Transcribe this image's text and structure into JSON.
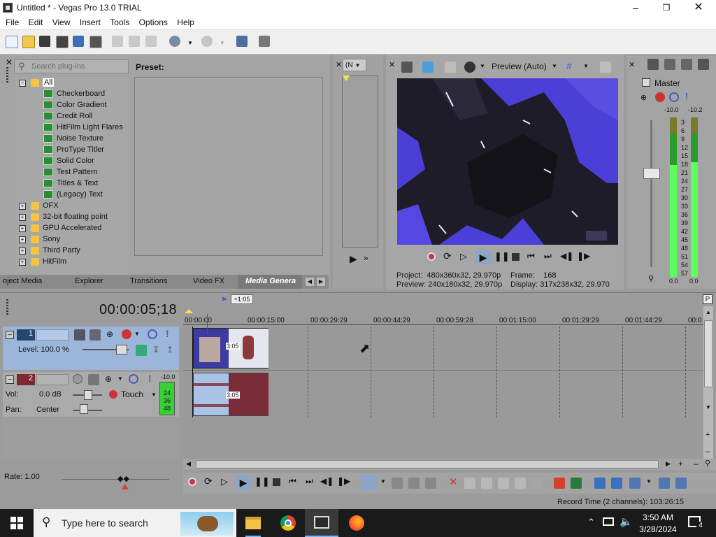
{
  "window": {
    "title": "Untitled * - Vegas Pro 13.0 TRIAL"
  },
  "menu": [
    "File",
    "Edit",
    "View",
    "Insert",
    "Tools",
    "Options",
    "Help"
  ],
  "plugins": {
    "search_placeholder": "Search plug-ins",
    "preset_label": "Preset:",
    "tree": [
      {
        "label": "All",
        "level": 0,
        "type": "folder",
        "expanded": true,
        "selected": true
      },
      {
        "label": "Checkerboard",
        "level": 1,
        "type": "plugin"
      },
      {
        "label": "Color Gradient",
        "level": 1,
        "type": "plugin"
      },
      {
        "label": "Credit Roll",
        "level": 1,
        "type": "plugin"
      },
      {
        "label": "HitFilm Light Flares",
        "level": 1,
        "type": "plugin"
      },
      {
        "label": "Noise Texture",
        "level": 1,
        "type": "plugin"
      },
      {
        "label": "ProType Titler",
        "level": 1,
        "type": "plugin"
      },
      {
        "label": "Solid Color",
        "level": 1,
        "type": "plugin"
      },
      {
        "label": "Test Pattern",
        "level": 1,
        "type": "plugin"
      },
      {
        "label": "Titles & Text",
        "level": 1,
        "type": "plugin"
      },
      {
        "label": "(Legacy) Text",
        "level": 1,
        "type": "plugin"
      },
      {
        "label": "OFX",
        "level": 0,
        "type": "folder"
      },
      {
        "label": "32-bit floating point",
        "level": 0,
        "type": "folder"
      },
      {
        "label": "GPU Accelerated",
        "level": 0,
        "type": "folder"
      },
      {
        "label": "Sony",
        "level": 0,
        "type": "folder"
      },
      {
        "label": "Third Party",
        "level": 0,
        "type": "folder"
      },
      {
        "label": "HitFilm",
        "level": 0,
        "type": "folder"
      }
    ]
  },
  "tabs": [
    {
      "label": "oject Media",
      "active": false
    },
    {
      "label": "Explorer",
      "active": false
    },
    {
      "label": "Transitions",
      "active": false
    },
    {
      "label": "Video FX",
      "active": false
    },
    {
      "label": "Media Genera",
      "active": true
    }
  ],
  "trimmer": {
    "dropdown": "(N"
  },
  "preview": {
    "mode_label": "Preview (Auto)",
    "project_label": "Project:",
    "project_value": "480x360x32, 29.970p",
    "frame_label": "Frame:",
    "frame_value": "168",
    "preview_label": "Preview:",
    "preview_value": "240x180x32, 29.970p",
    "display_label": "Display:",
    "display_value": "317x238x32, 29.970"
  },
  "master": {
    "label": "Master",
    "peak_left": "-10.0",
    "peak_right": "-10.2",
    "scale": [
      "3",
      "6",
      "9",
      "12",
      "15",
      "18",
      "21",
      "24",
      "27",
      "30",
      "33",
      "36",
      "39",
      "42",
      "45",
      "48",
      "51",
      "54",
      "57"
    ],
    "bottom_left": "0.0",
    "bottom_right": "0.0",
    "level_left": 0.7,
    "level_right": 0.72
  },
  "timeline": {
    "time": "00:00:05;18",
    "cursor_badge": "+1:05",
    "ruler": [
      "00:00:00",
      "00:00:15:00",
      "00:00:29:29",
      "00:00:44:29",
      "00:00:59:28",
      "00:01:15:00",
      "00:01:29:29",
      "00:01:44:29",
      "00:0"
    ],
    "clip_label": "3:05"
  },
  "track1": {
    "number": "1",
    "level_label": "Level: 100.0 %"
  },
  "track2": {
    "number": "2",
    "vol_label": "Vol:",
    "vol_value": "0.0 dB",
    "pan_label": "Pan:",
    "pan_value": "Center",
    "mode": "Touch",
    "meter_top": "-10.0",
    "meter_marks": [
      "24",
      "36",
      "48"
    ]
  },
  "rate": "Rate: 1.00",
  "status": "Record Time (2 channels): 103:26:15",
  "taskbar": {
    "search_placeholder": "Type here to search",
    "time": "3:50 AM",
    "date": "3/28/2024",
    "notifications": "4"
  },
  "colors": {
    "accent": "#4a3fd6",
    "meter_green": "#5dff5d",
    "track_blue": "#9bb6d9"
  }
}
